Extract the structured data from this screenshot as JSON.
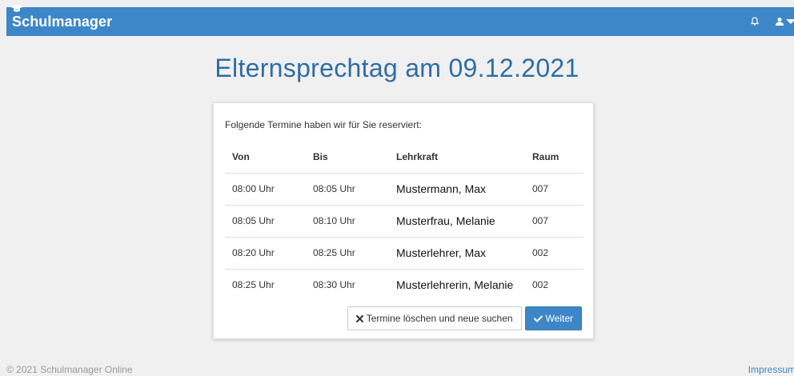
{
  "navbar": {
    "brand": "Schulmanager",
    "bell_icon": "bell-icon",
    "user_icon": "user-icon"
  },
  "page": {
    "title": "Elternsprechtag am 09.12.2021"
  },
  "card": {
    "intro": "Folgende Termine haben wir für Sie reserviert:",
    "columns": {
      "von": "Von",
      "bis": "Bis",
      "lehrkraft": "Lehrkraft",
      "raum": "Raum"
    },
    "rows": [
      {
        "von": "08:00 Uhr",
        "bis": "08:05 Uhr",
        "lehrkraft": "Mustermann, Max",
        "raum": "007"
      },
      {
        "von": "08:05 Uhr",
        "bis": "08:10 Uhr",
        "lehrkraft": "Musterfrau, Melanie",
        "raum": "007"
      },
      {
        "von": "08:20 Uhr",
        "bis": "08:25 Uhr",
        "lehrkraft": "Musterlehrer, Max",
        "raum": "002"
      },
      {
        "von": "08:25 Uhr",
        "bis": "08:30 Uhr",
        "lehrkraft": "Musterlehrerin, Melanie",
        "raum": "002"
      }
    ],
    "delete_button": "Termine löschen und neue suchen",
    "continue_button": "Weiter"
  },
  "footer": {
    "copyright": "© 2021 Schulmanager Online",
    "impressum": "Impressum"
  },
  "colors": {
    "brand_blue": "#3d87c8",
    "title_blue": "#2e6da4",
    "background": "#f0f0f0"
  }
}
